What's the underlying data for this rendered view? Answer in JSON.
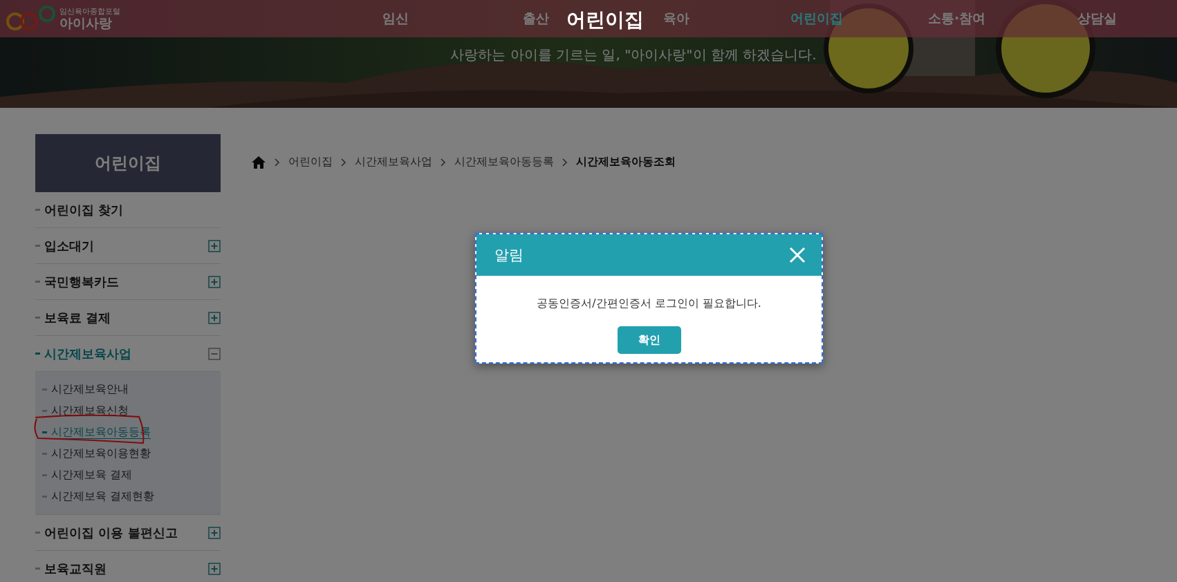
{
  "logo": {
    "caption": "임신육아종합포털",
    "name": "아이사랑"
  },
  "nav": [
    {
      "label": "임신",
      "selected": false
    },
    {
      "label": "출산",
      "selected": false
    },
    {
      "label": "육아",
      "selected": false
    },
    {
      "label": "어린이집",
      "selected": true
    },
    {
      "label": "소통·참여",
      "selected": false
    },
    {
      "label": "상담실",
      "selected": false
    }
  ],
  "banner": {
    "title": "어린이집",
    "subtitle": "사랑하는 아이를 기르는 일, \"아이사랑\"이 함께 하겠습니다."
  },
  "sidebar": {
    "title": "어린이집",
    "items": [
      {
        "label": "어린이집 찾기",
        "kind": "link",
        "selected": false
      },
      {
        "label": "입소대기",
        "kind": "group",
        "selected": false,
        "expanded": false
      },
      {
        "label": "국민행복카드",
        "kind": "group",
        "selected": false,
        "expanded": false
      },
      {
        "label": "보육료 결제",
        "kind": "group",
        "selected": false,
        "expanded": false
      },
      {
        "label": "시간제보육사업",
        "kind": "group",
        "selected": true,
        "expanded": true,
        "children": [
          {
            "label": "시간제보육안내",
            "selected": false
          },
          {
            "label": "시간제보육신청",
            "selected": false
          },
          {
            "label": "시간제보육아동등록",
            "selected": true
          },
          {
            "label": "시간제보육이용현황",
            "selected": false
          },
          {
            "label": "시간제보육 결제",
            "selected": false
          },
          {
            "label": "시간제보육 결제현황",
            "selected": false
          }
        ]
      },
      {
        "label": "어린이집 이용 불편신고",
        "kind": "group",
        "selected": false,
        "expanded": false
      },
      {
        "label": "보육교직원",
        "kind": "group",
        "selected": false,
        "expanded": false
      }
    ]
  },
  "breadcrumb": [
    {
      "label": "어린이집",
      "current": false
    },
    {
      "label": "시간제보육사업",
      "current": false
    },
    {
      "label": "시간제보육아동등록",
      "current": false
    },
    {
      "label": "시간제보육아동조회",
      "current": true
    }
  ],
  "dialog": {
    "title": "알림",
    "message": "공동인증서/간편인증서 로그인이 필요합니다.",
    "button": "확인",
    "focused": true
  }
}
